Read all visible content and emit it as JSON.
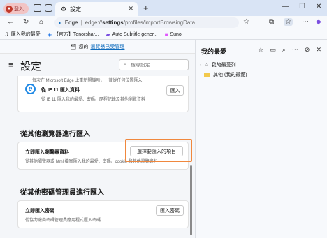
{
  "browser": {
    "profile_label": "登入",
    "tab_title": "設定",
    "new_tab_symbol": "+",
    "address": {
      "host": "Edge",
      "separator": "|",
      "url_prefix": "edge://",
      "url_bold": "settings",
      "url_rest": "/profiles/importBrowsingData"
    }
  },
  "bookmarks": [
    {
      "label": "匯入我的最愛",
      "icon": "import-icon"
    },
    {
      "label": "【官方】Tenorshar...",
      "icon": "tenorshare-icon"
    },
    {
      "label": "Auto Subtitle gener...",
      "icon": "subtitle-icon"
    },
    {
      "label": "Suno",
      "icon": "suno-icon"
    }
  ],
  "settings": {
    "banner_text": "您的",
    "banner_link": "瀏覽器已受管理",
    "title": "設定",
    "search_placeholder": "搜尋設定",
    "ie_card": {
      "cut_text": "每次在 Microsoft Edge 上重新開機時，一律從任何位置匯入",
      "title": "從 IE 11 匯入資料",
      "desc": "從 IE 11 匯入我的最愛、密碼、歷程記錄及其他瀏覽資料",
      "button": "匯入"
    },
    "section_browsers": "從其他瀏覽器進行匯入",
    "browser_card": {
      "title": "立即匯入瀏覽器資料",
      "desc": "從其他瀏覽器或 html 檔案匯入我的最愛、密碼、cookie 和其他瀏覽資料",
      "button": "選擇要匯入的項目"
    },
    "section_passwords": "從其他密碼管理員進行匯入",
    "password_card": {
      "title": "立即匯入密碼",
      "desc": "從協力廠商密碼管理員應用程式匯入密碼",
      "button": "匯入密碼"
    }
  },
  "favorites": {
    "title": "我的最愛",
    "items": [
      {
        "label": "我的最愛列",
        "icon": "star-icon"
      },
      {
        "label": "其他 (我的最愛)",
        "icon": "folder-icon"
      }
    ]
  },
  "colors": {
    "accent": "#0f6cbd",
    "highlight": "#f0883e"
  }
}
